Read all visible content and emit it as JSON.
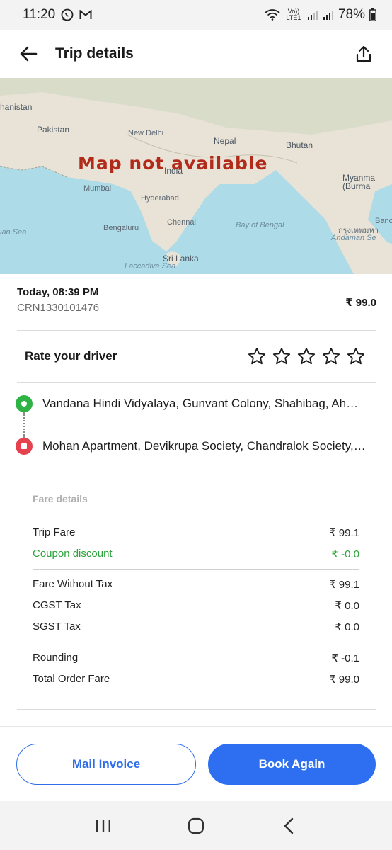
{
  "status_bar": {
    "time": "11:20",
    "network": "Vo)) LTE1",
    "battery": "78%"
  },
  "header": {
    "title": "Trip details"
  },
  "map": {
    "overlay_text": "Map not available",
    "labels": {
      "afghanistan": "hanistan",
      "pakistan": "Pakistan",
      "new_delhi": "New Delhi",
      "nepal": "Nepal",
      "bhutan": "Bhutan",
      "india": "India",
      "myanmar": "Myanma",
      "burma": "(Burma",
      "mumbai": "Mumbai",
      "hyderabad": "Hyderabad",
      "chennai": "Chennai",
      "bengaluru": "Bengaluru",
      "bay_of_bengal": "Bay of Bengal",
      "bangkok": "Banc",
      "bangkok_thai": "กรุงเทพมหา",
      "andaman": "Andaman Se",
      "arabian_sea": "ian Sea",
      "sri_lanka": "Sri Lanka",
      "laccadive": "Laccadive Sea"
    }
  },
  "trip": {
    "time": "Today, 08:39 PM",
    "crn": "CRN1330101476",
    "price": "₹ 99.0"
  },
  "rating": {
    "label": "Rate your driver",
    "stars": 5
  },
  "route": {
    "pickup": "Vandana Hindi Vidyalaya, Gunvant Colony, Shahibag, Ahmedabad",
    "drop": "Mohan Apartment, Devikrupa Society, Chandralok Society, Ahmedabad"
  },
  "fare": {
    "heading": "Fare details",
    "rows": [
      {
        "label": "Trip Fare",
        "value": "₹ 99.1"
      },
      {
        "label": "Coupon discount",
        "value": "₹ -0.0"
      },
      {
        "label": "Fare Without Tax",
        "value": "₹ 99.1"
      },
      {
        "label": "CGST Tax",
        "value": "₹ 0.0"
      },
      {
        "label": "SGST Tax",
        "value": "₹ 0.0"
      },
      {
        "label": "Rounding",
        "value": "₹ -0.1"
      },
      {
        "label": "Total Order Fare",
        "value": "₹ 99.0"
      }
    ]
  },
  "actions": {
    "mail_invoice": "Mail Invoice",
    "book_again": "Book Again"
  },
  "colors": {
    "primary": "#2d6ff0",
    "pickup": "#2fb344",
    "drop": "#e5414e",
    "coupon": "#2ba33a",
    "map_text": "#b22a1a"
  }
}
